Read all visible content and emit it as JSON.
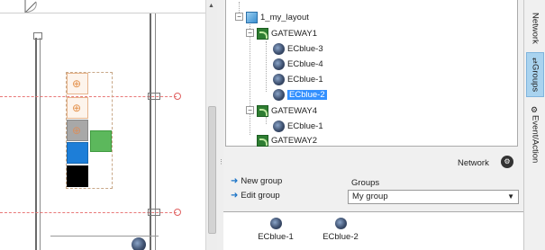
{
  "canvas": {
    "icon": "floorplan-layout"
  },
  "tree": {
    "root": {
      "label": "1_my_layout",
      "icon": "layout-icon"
    },
    "gateways": [
      {
        "label": "GATEWAY1",
        "icon": "gateway-icon",
        "devices": [
          {
            "label": "ECblue-3",
            "icon": "device-icon"
          },
          {
            "label": "ECblue-4",
            "icon": "device-icon"
          },
          {
            "label": "ECblue-1",
            "icon": "device-icon"
          },
          {
            "label": "ECblue-2",
            "icon": "device-icon",
            "selected": true
          }
        ]
      },
      {
        "label": "GATEWAY4",
        "icon": "gateway-icon",
        "devices": [
          {
            "label": "ECblue-1",
            "icon": "device-icon"
          }
        ]
      },
      {
        "label": "GATEWAY2",
        "icon": "gateway-icon",
        "devices": []
      }
    ]
  },
  "network": {
    "label": "Network",
    "icon": "network-icon"
  },
  "actions": {
    "new_group": "New group",
    "edit_group": "Edit group"
  },
  "groups": {
    "label": "Groups",
    "selected": "My group"
  },
  "members": [
    {
      "label": "ECblue-1"
    },
    {
      "label": "ECblue-2"
    }
  ],
  "tabs": [
    {
      "label": "Network"
    },
    {
      "label": "Groups",
      "active": true
    },
    {
      "label": "Event/Action"
    }
  ],
  "colors": {
    "selection": "#3390ff",
    "active_tab": "#a9d3ef",
    "gateway": "#2e7d32",
    "guide": "#e87878"
  }
}
